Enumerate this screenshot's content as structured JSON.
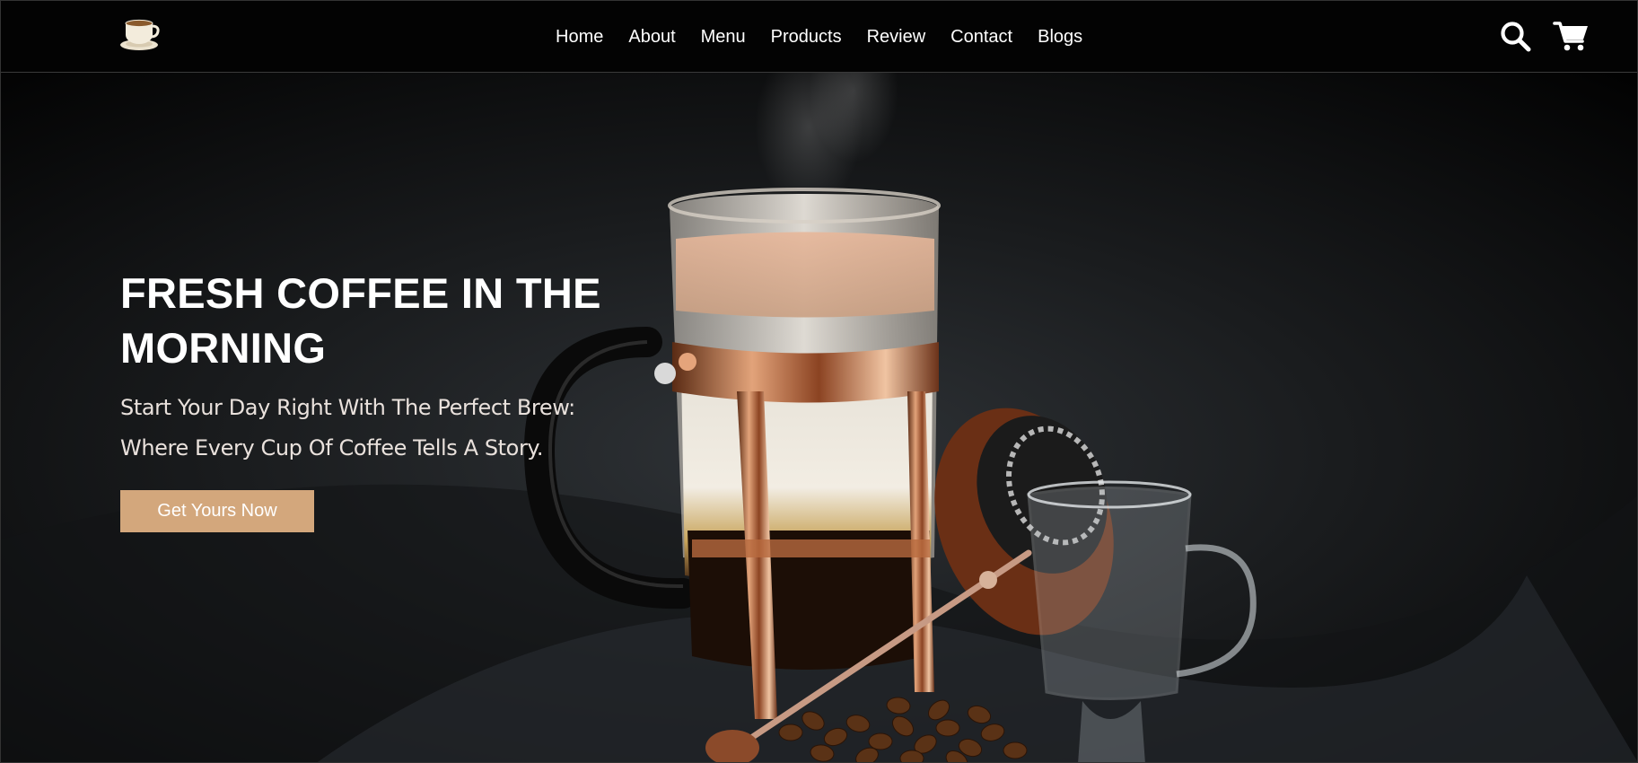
{
  "brand": {
    "logo_icon": "coffee-cup-icon"
  },
  "nav": {
    "items": [
      {
        "label": "Home"
      },
      {
        "label": "About"
      },
      {
        "label": "Menu"
      },
      {
        "label": "Products"
      },
      {
        "label": "Review"
      },
      {
        "label": "Contact"
      },
      {
        "label": "Blogs"
      }
    ]
  },
  "header_actions": {
    "search_icon": "search-icon",
    "cart_icon": "cart-icon"
  },
  "hero": {
    "title": "FRESH COFFEE IN THE MORNING",
    "subtitle": "Start Your Day Right With The Perfect Brew: Where Every Cup Of Coffee Tells A Story.",
    "cta_label": "Get Yours Now",
    "background_image": "french-press-coffee-photo"
  },
  "colors": {
    "header_bg": "#030303",
    "accent": "#d3a77c",
    "text": "#ffffff"
  }
}
